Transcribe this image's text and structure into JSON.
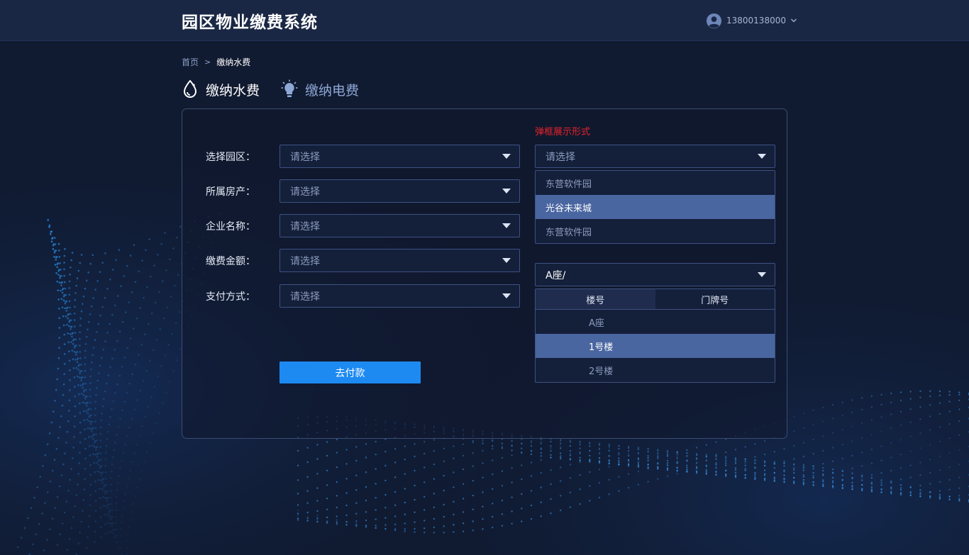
{
  "header": {
    "app_title": "园区物业缴费系统",
    "user_phone": "13800138000"
  },
  "breadcrumb": {
    "home": "首页",
    "separator": ">",
    "current": "缴纳水费"
  },
  "tabs": [
    {
      "label": "缴纳水费",
      "icon": "water-drop-icon",
      "active": true
    },
    {
      "label": "缴纳电费",
      "icon": "lightbulb-icon",
      "active": false
    }
  ],
  "form": {
    "rows": [
      {
        "label": "选择园区：",
        "placeholder": "请选择"
      },
      {
        "label": "所属房产：",
        "placeholder": "请选择"
      },
      {
        "label": "企业名称：",
        "placeholder": "请选择"
      },
      {
        "label": "缴费金额：",
        "placeholder": "请选择"
      },
      {
        "label": "支付方式：",
        "placeholder": "请选择"
      }
    ],
    "submit_label": "去付款"
  },
  "demo": {
    "note": "弹框展示形式",
    "park_select": {
      "placeholder": "请选择",
      "options": [
        "东营软件园",
        "光谷未来城",
        "东营软件园"
      ],
      "selected_index": 1
    },
    "building_select": {
      "value": "A座/",
      "tabs": [
        "楼号",
        "门牌号"
      ],
      "active_tab": 0,
      "options": [
        "A座",
        "1号楼",
        "2号楼"
      ],
      "selected_index": 1
    }
  },
  "colors": {
    "page_bg": "#101a30",
    "topbar_bg": "#1a2744",
    "primary_button": "#1d8af2",
    "selected_option": "#4a66a1",
    "note_red": "#e5222a"
  }
}
